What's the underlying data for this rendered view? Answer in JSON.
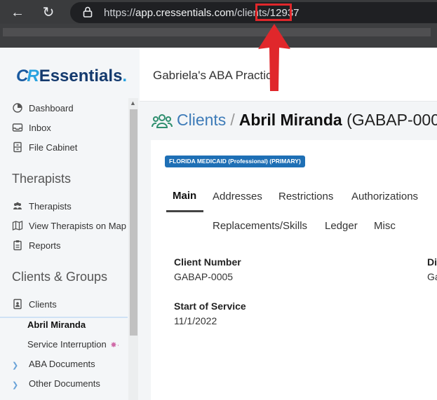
{
  "browser": {
    "url_prefix": "https://",
    "url_host": "app.cressentials.com",
    "url_path": "/clients/",
    "url_id": "12937"
  },
  "logo": {
    "c": "C",
    "r": "R",
    "rest": "Essentials",
    "dot": "."
  },
  "sidebar": {
    "items_top": [
      {
        "label": "Dashboard",
        "icon": "dashboard-icon"
      },
      {
        "label": "Inbox",
        "icon": "inbox-icon"
      },
      {
        "label": "File Cabinet",
        "icon": "file-cabinet-icon"
      }
    ],
    "section_therapists": "Therapists",
    "items_therapists": [
      {
        "label": "Therapists",
        "icon": "users-icon"
      },
      {
        "label": "View Therapists on Map",
        "icon": "map-icon"
      },
      {
        "label": "Reports",
        "icon": "clipboard-icon"
      }
    ],
    "section_clients": "Clients & Groups",
    "clients_label": "Clients",
    "sub_active": "Abril Miranda",
    "sub_service": "Service Interruption",
    "aba_documents": "ABA Documents",
    "other_documents": "Other Documents"
  },
  "header": {
    "practice": "Gabriela's ABA Practice"
  },
  "breadcrumb": {
    "section": "Clients",
    "separator": "/",
    "client_name": "Abril Miranda",
    "client_code": "(GABAP-000"
  },
  "badge": "FLORIDA MEDICAID (Professional) (PRIMARY)",
  "tabs": {
    "row1": [
      "Main",
      "Addresses",
      "Restrictions",
      "Authorizations"
    ],
    "row2": [
      "Replacements/Skills",
      "Ledger",
      "Misc"
    ]
  },
  "fields": {
    "client_number_label": "Client Number",
    "client_number_value": "GABAP-0005",
    "start_label": "Start of Service",
    "start_value": "11/1/2022",
    "cut_label": "Di",
    "cut_value": "Ga"
  },
  "colors": {
    "accent": "#1e6fb5",
    "link": "#3d7bb8",
    "highlight": "#e0272b"
  }
}
